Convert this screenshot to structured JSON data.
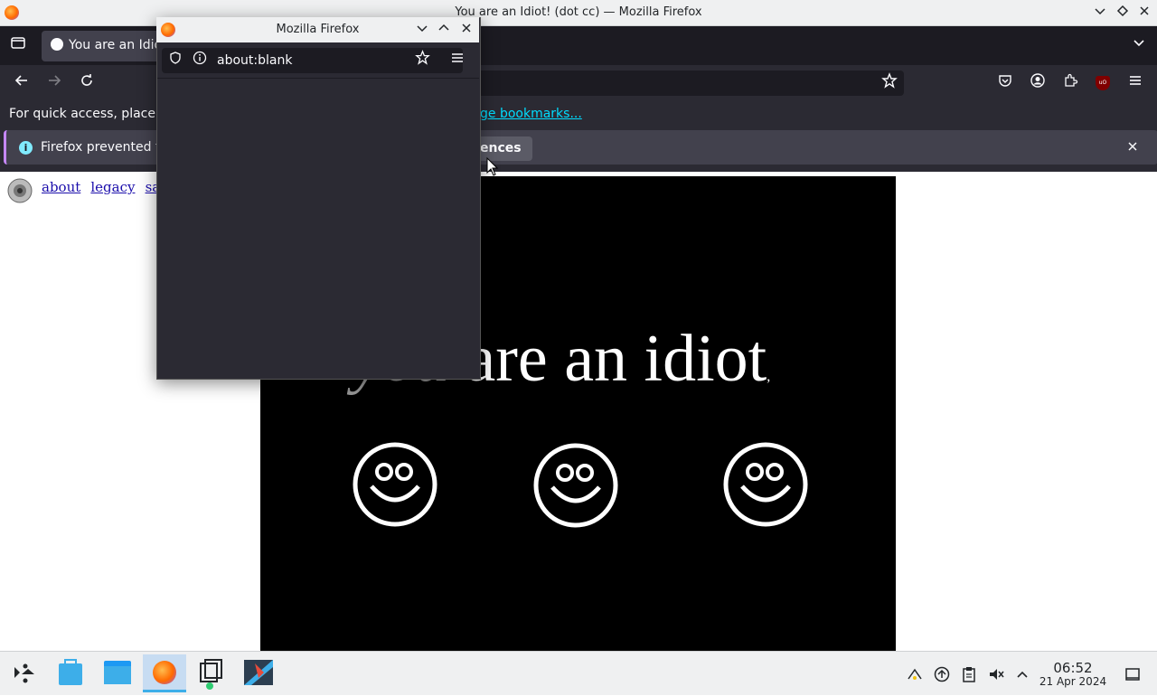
{
  "window": {
    "title": "You are an Idiot! (dot cc) — Mozilla Firefox"
  },
  "tabs": [
    {
      "label": "You are an Idiot! (dot cc)"
    }
  ],
  "bookmarks_bar": {
    "prefix": "For quick access, place y",
    "link": "ge bookmarks..."
  },
  "notification": {
    "text": "Firefox prevented t",
    "button_label": "ences"
  },
  "page": {
    "links": [
      "about",
      "legacy",
      "safe"
    ],
    "headline_dim": "you",
    "headline_bright": " are an idiot",
    "trailing_mark": ","
  },
  "popup": {
    "title": "Mozilla Firefox",
    "url": "about:blank"
  },
  "taskbar": {
    "clock_time": "06:52",
    "clock_date": "21 Apr 2024"
  },
  "colors": {
    "firefox_dark": "#2b2a33",
    "tab_dark": "#1c1b22",
    "accent_blue": "#3daee9",
    "link_cyan": "#00ddff"
  }
}
